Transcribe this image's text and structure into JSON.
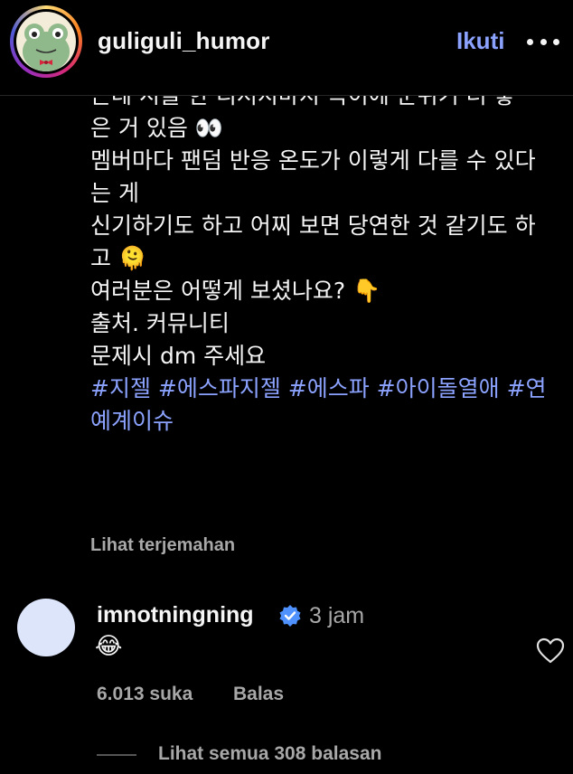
{
  "header": {
    "username": "guliguli_humor",
    "follow_label": "Ikuti"
  },
  "caption": {
    "line0": "근데 시들 한 디저지마지 득이에 군위기 더 좋",
    "line1": "은 거 있음 👀",
    "line2": "멤버마다 팬덤 반응 온도가 이렇게 다를 수 있다",
    "line3": "는 게",
    "line4": "신기하기도 하고 어찌 보면 당연한 것 같기도 하",
    "line5": "고 🫠",
    "line6": "여러분은 어떻게 보셨나요? 👇",
    "line7": "출처. 커뮤니티",
    "line8": "문제시 dm 주세요",
    "hashtags_line1": "#지젤 #에스파지젤 #에스파 #아이돌열애 #연",
    "hashtags_line2": "예계이슈"
  },
  "translate_label": "Lihat terjemahan",
  "comment": {
    "username": "imnotningning",
    "time": "3 jam",
    "text": "😂",
    "likes": "6.013 suka",
    "reply_label": "Balas",
    "view_replies": "Lihat semua 308 balasan"
  },
  "colors": {
    "background": "#000000",
    "link_blue": "#8ba2ff",
    "muted": "#a8a8a8",
    "verified": "#4f92ff"
  }
}
